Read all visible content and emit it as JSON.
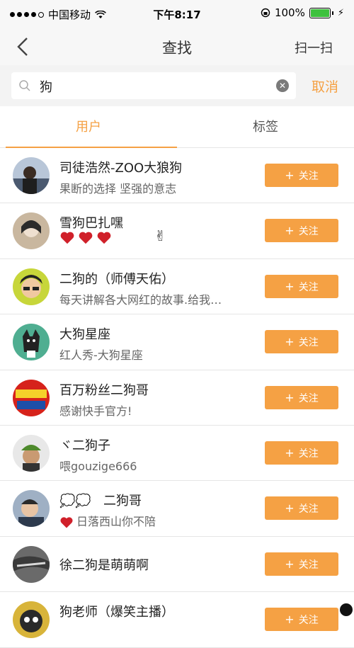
{
  "status_bar": {
    "carrier": "中国移动",
    "time": "下午8:17",
    "battery": "100%"
  },
  "nav": {
    "title": "查找",
    "scan_label": "扫一扫"
  },
  "search": {
    "value": "狗",
    "cancel_label": "取消"
  },
  "tabs": [
    {
      "label": "用户",
      "active": true
    },
    {
      "label": "标签",
      "active": false
    }
  ],
  "follow_label": "关注",
  "users": [
    {
      "name": "司徒浩然-ZOO大狼狗",
      "bio": "果断的选择 坚强的意志",
      "avatar_color": "#7a8fa8"
    },
    {
      "name": "雪狗巴扎嘿",
      "bio": "",
      "avatar_color": "#c9b79f"
    },
    {
      "name": "二狗的（师傅天佑）",
      "bio": "每天讲解各大网红的故事.给我…",
      "avatar_color": "#d9a441"
    },
    {
      "name": "大狗星座",
      "bio": "红人秀-大狗星座",
      "avatar_color": "#4fae91"
    },
    {
      "name": "百万粉丝二狗哥",
      "bio": "感谢快手官方!",
      "avatar_color": "#d6221b"
    },
    {
      "name": "ヾ二狗子",
      "bio": "喂gouzige666",
      "avatar_color": "#6a8c4f"
    },
    {
      "name": "二狗哥",
      "bio": "日落西山你不陪",
      "avatar_color": "#8a9bb0"
    },
    {
      "name": "徐二狗是萌萌啊",
      "bio": "",
      "avatar_color": "#5b5b5b"
    },
    {
      "name": "狗老师（爆笑主播）",
      "bio": "",
      "avatar_color": "#d8b43a"
    }
  ],
  "colors": {
    "accent": "#f5a144",
    "battery": "#3dc13d"
  }
}
